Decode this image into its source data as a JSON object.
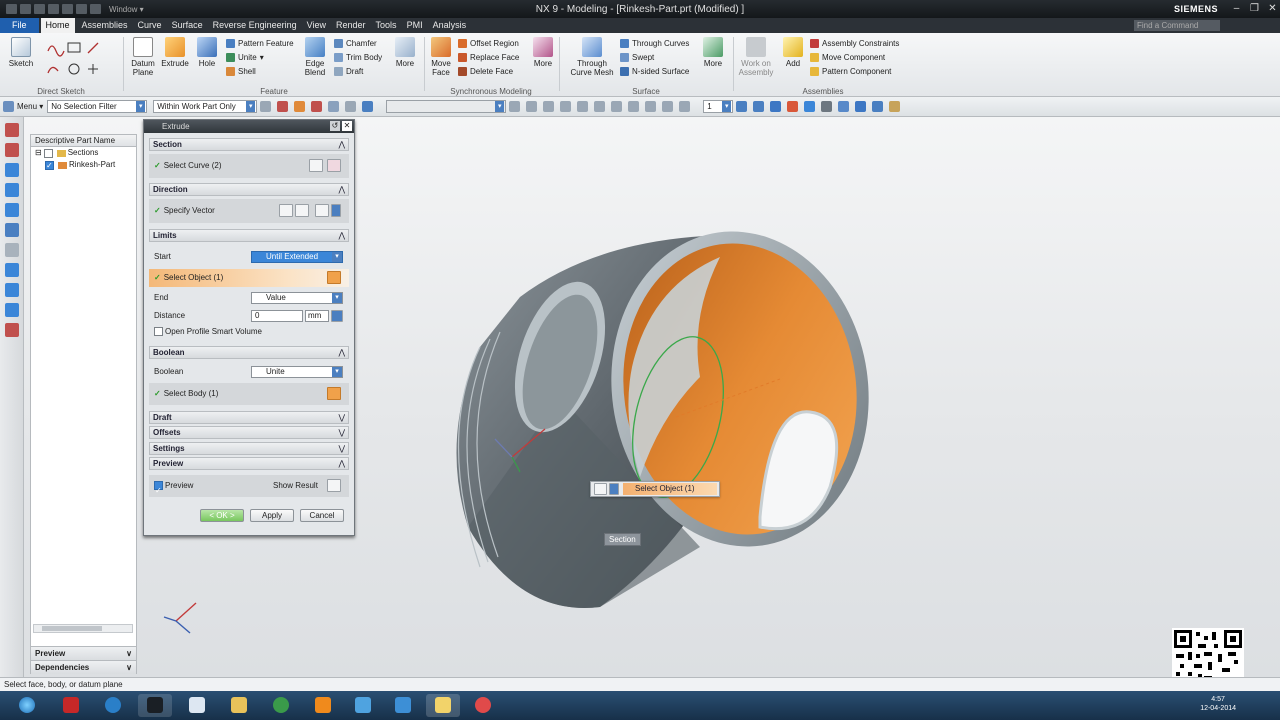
{
  "window": {
    "title": "NX 9 - Modeling - [Rinkesh-Part.prt (Modified) ]",
    "window_menu": "Window ▾",
    "brand": "SIEMENS",
    "command_finder_placeholder": "Find a Command"
  },
  "menubar": [
    "File",
    "Home",
    "Assemblies",
    "Curve",
    "Surface",
    "Reverse Engineering",
    "View",
    "Render",
    "Tools",
    "PMI",
    "Analysis"
  ],
  "ribbon": {
    "direct_sketch": {
      "label": "Direct Sketch",
      "sketch": "Sketch"
    },
    "feature": {
      "label": "Feature",
      "datum_plane": "Datum Plane",
      "extrude": "Extrude",
      "hole": "Hole",
      "pattern_feature": "Pattern Feature",
      "unite": "Unite",
      "shell": "Shell",
      "edge_blend": "Edge Blend",
      "chamfer": "Chamfer",
      "trim_body": "Trim Body",
      "draft": "Draft",
      "more": "More"
    },
    "sync": {
      "label": "Synchronous Modeling",
      "move_face": "Move Face",
      "offset_region": "Offset Region",
      "replace_face": "Replace Face",
      "delete_face": "Delete Face",
      "more": "More"
    },
    "surface": {
      "label": "Surface",
      "through_curve_mesh": "Through Curve Mesh",
      "through_curves": "Through Curves",
      "swept": "Swept",
      "n_sided": "N-sided Surface",
      "more": "More"
    },
    "assemblies": {
      "label": "Assemblies",
      "work_on": "Work on Assembly",
      "add": "Add",
      "constraints": "Assembly Constraints",
      "move_component": "Move Component",
      "pattern_component": "Pattern Component"
    }
  },
  "toolbar": {
    "menu": "Menu ▾",
    "selection_filter": "No Selection Filter",
    "scope": "Within Work Part Only",
    "snap_value": "1"
  },
  "part_navigator": {
    "header": "Descriptive Part Name",
    "items": [
      "Sections",
      "Rinkesh-Part"
    ],
    "preview": "Preview",
    "dependencies": "Dependencies"
  },
  "extrude_dialog": {
    "title": "Extrude",
    "section_header": "Section",
    "select_curve": "Select Curve (2)",
    "direction_header": "Direction",
    "specify_vector": "Specify Vector",
    "limits_header": "Limits",
    "start_label": "Start",
    "start_value": "Until Extended",
    "select_object": "Select Object (1)",
    "end_label": "End",
    "end_value": "Value",
    "distance_label": "Distance",
    "distance_value": "0",
    "distance_unit": "mm",
    "open_profile": "Open Profile Smart Volume",
    "boolean_header": "Boolean",
    "boolean_label": "Boolean",
    "boolean_value": "Unite",
    "select_body": "Select Body (1)",
    "draft_header": "Draft",
    "offsets_header": "Offsets",
    "settings_header": "Settings",
    "preview_header": "Preview",
    "preview_check": "Preview",
    "show_result": "Show Result",
    "ok": "< OK >",
    "apply": "Apply",
    "cancel": "Cancel"
  },
  "viewport": {
    "float_select": "Select Object (1)",
    "section_tag": "Section"
  },
  "status": "Select face, body, or datum plane",
  "clock": {
    "time": "4:57",
    "date": "12-04-2014"
  },
  "colors": {
    "accent": "#3b86d8",
    "highlight": "#f4b070",
    "model": "#6c7479",
    "interior": "#e8913a"
  }
}
